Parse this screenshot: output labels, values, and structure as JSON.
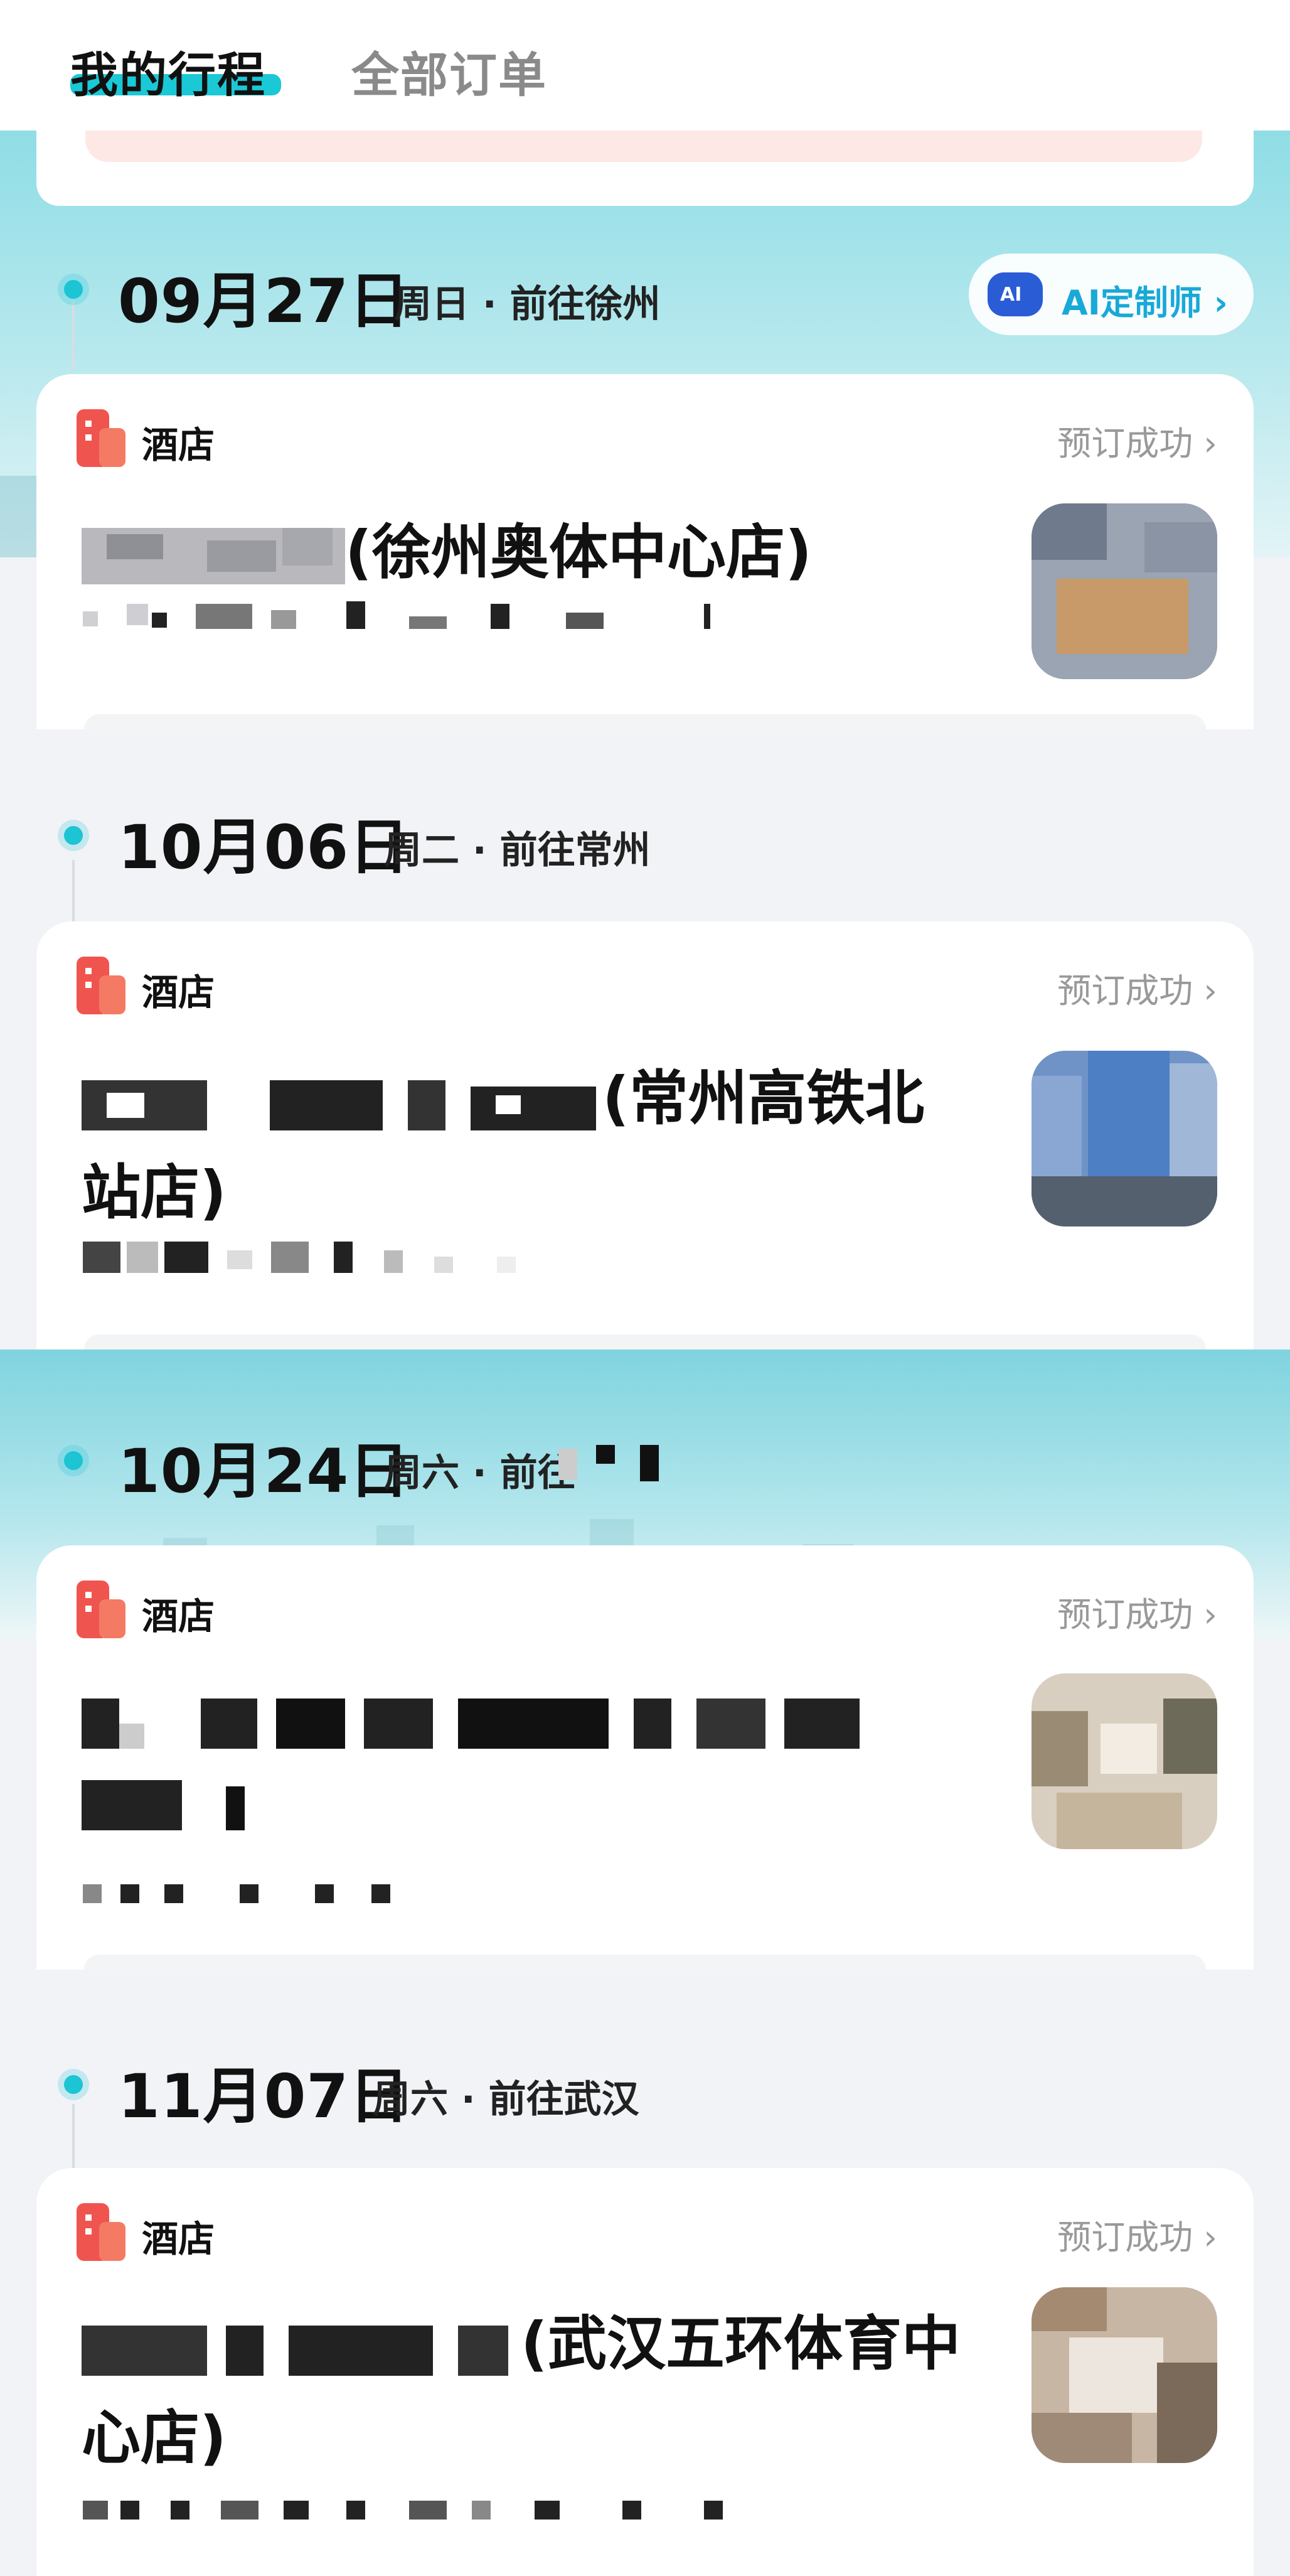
{
  "tabs": [
    {
      "label": "我的行程",
      "active": true
    },
    {
      "label": "全部订单",
      "active": false
    }
  ],
  "ai_button": {
    "label": "AI定制师 ›",
    "badge": "AI"
  },
  "trips": [
    {
      "date": "09月27日",
      "sub": "周日 · 前往徐州",
      "card": {
        "type": "酒店",
        "status": "预订成功 ›",
        "name_visible": "(徐州奥体中心店)"
      }
    },
    {
      "date": "10月06日",
      "sub": "周二 · 前往常州",
      "card": {
        "type": "酒店",
        "status": "预订成功 ›",
        "name_visible": "(常州高铁北",
        "name_line2": "站店)"
      }
    },
    {
      "date": "10月24日",
      "sub": "周六 · 前往",
      "card": {
        "type": "酒店",
        "status": "预订成功 ›"
      }
    },
    {
      "date": "11月07日",
      "sub": "周六 · 前往武汉",
      "card": {
        "type": "酒店",
        "status": "预订成功 ›",
        "name_visible": "(武汉五环体育中",
        "name_line2": "心店)"
      }
    }
  ],
  "colors": {
    "accent": "#1bc8d6",
    "hotel_icon": "#f0544f",
    "status": "#999999"
  }
}
